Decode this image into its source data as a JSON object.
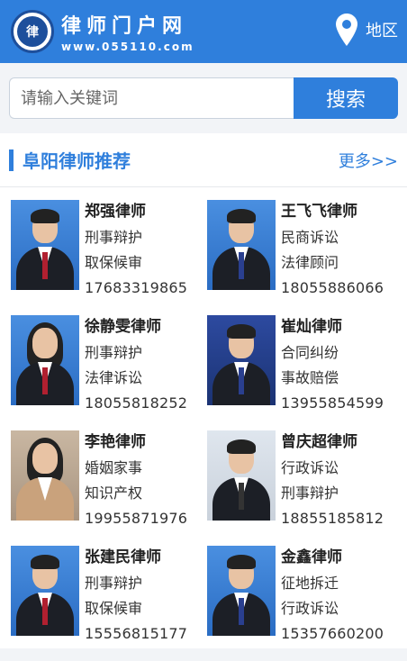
{
  "header": {
    "logo_text": "律",
    "brand_name": "律师门户网",
    "brand_url": "www.055110.com",
    "region_label": "地区"
  },
  "search": {
    "placeholder": "请输入关键词",
    "button_label": "搜索"
  },
  "section": {
    "title": "阜阳律师推荐",
    "more_label": "更多>>"
  },
  "lawyers": [
    {
      "name": "郑强律师",
      "tag1": "刑事辩护",
      "tag2": "取保候审",
      "phone": "17683319865"
    },
    {
      "name": "王飞飞律师",
      "tag1": "民商诉讼",
      "tag2": "法律顾问",
      "phone": "18055886066"
    },
    {
      "name": "徐静雯律师",
      "tag1": "刑事辩护",
      "tag2": "法律诉讼",
      "phone": "18055818252"
    },
    {
      "name": "崔灿律师",
      "tag1": "合同纠纷",
      "tag2": "事故赔偿",
      "phone": "13955854599"
    },
    {
      "name": "李艳律师",
      "tag1": "婚姻家事",
      "tag2": "知识产权",
      "phone": "19955871976"
    },
    {
      "name": "曾庆超律师",
      "tag1": "行政诉讼",
      "tag2": "刑事辩护",
      "phone": "18855185812"
    },
    {
      "name": "张建民律师",
      "tag1": "刑事辩护",
      "tag2": "取保候审",
      "phone": "15556815177"
    },
    {
      "name": "金鑫律师",
      "tag1": "征地拆迁",
      "tag2": "行政诉讼",
      "phone": "15357660200"
    }
  ],
  "colors": {
    "accent": "#2f7fdc",
    "background": "#f2f4f7"
  }
}
